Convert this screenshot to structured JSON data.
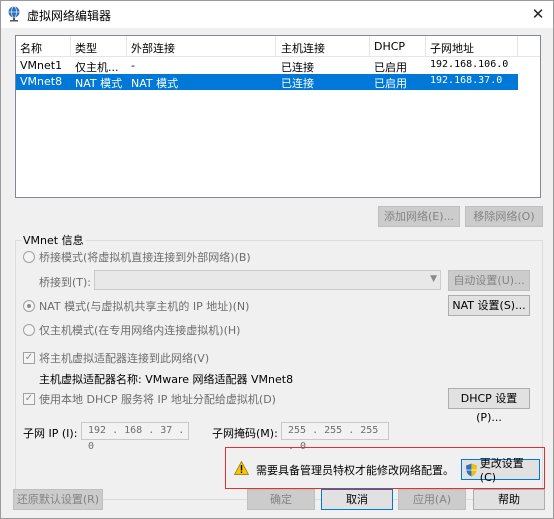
{
  "window": {
    "title": "虚拟网络编辑器",
    "close_symbol": "✕"
  },
  "table": {
    "headers": [
      "名称",
      "类型",
      "外部连接",
      "主机连接",
      "DHCP",
      "子网地址"
    ],
    "rows": [
      {
        "name": "VMnet1",
        "type": "仅主机...",
        "external": "-",
        "host": "已连接",
        "dhcp": "已启用",
        "subnet": "192.168.106.0",
        "selected": false
      },
      {
        "name": "VMnet8",
        "type": "NAT 模式",
        "external": "NAT 模式",
        "host": "已连接",
        "dhcp": "已启用",
        "subnet": "192.168.37.0",
        "selected": true
      }
    ]
  },
  "list_buttons": {
    "add": "添加网络(E)...",
    "remove": "移除网络(O)"
  },
  "vmnet_info": {
    "group_label": "VMnet 信息",
    "bridge_label": "桥接模式(将虚拟机直接连接到外部网络)(B)",
    "bridge_to_label": "桥接到(T):",
    "auto_settings": "自动设置(U)...",
    "nat_label": "NAT 模式(与虚拟机共享主机的 IP 地址)(N)",
    "nat_settings": "NAT 设置(S)...",
    "hostonly_label": "仅主机模式(在专用网络内连接虚拟机)(H)",
    "connect_adapter_label": "将主机虚拟适配器连接到此网络(V)",
    "adapter_name_label": "主机虚拟适配器名称: VMware 网络适配器 VMnet8",
    "dhcp_label": "使用本地 DHCP 服务将 IP 地址分配给虚拟机(D)",
    "dhcp_settings": "DHCP 设置(P)...",
    "subnet_ip_label": "子网 IP (I):",
    "subnet_ip_value": "192 . 168 . 37 . 0",
    "subnet_mask_label": "子网掩码(M):",
    "subnet_mask_value": "255 . 255 . 255 . 0",
    "selected_mode": "nat",
    "connect_adapter_checked": true,
    "dhcp_checked": true
  },
  "warning": {
    "text": "需要具备管理员特权才能修改网络配置。",
    "change_settings": "更改设置(C)"
  },
  "bottom_buttons": {
    "restore": "还原默认设置(R)",
    "ok": "确定",
    "cancel": "取消",
    "apply": "应用(A)",
    "help": "帮助"
  },
  "colors": {
    "selection": "#0078d7",
    "warning_border": "#e03030"
  },
  "icons": {
    "title": "network-globe-icon",
    "warning": "warning-triangle-icon",
    "shield": "uac-shield-icon"
  }
}
